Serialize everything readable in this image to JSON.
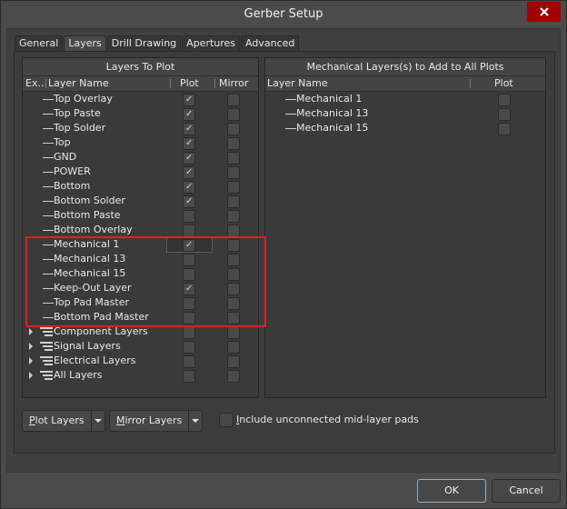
{
  "window": {
    "title": "Gerber Setup"
  },
  "tabs": [
    {
      "label": "General",
      "active": false
    },
    {
      "label": "Layers",
      "active": true
    },
    {
      "label": "Drill Drawing",
      "active": false
    },
    {
      "label": "Apertures",
      "active": false
    },
    {
      "label": "Advanced",
      "active": false
    }
  ],
  "layers_to_plot": {
    "title": "Layers To Plot",
    "columns": {
      "expand": "Ex...",
      "name": "Layer Name",
      "plot": "Plot",
      "mirror": "Mirror"
    },
    "layers": [
      {
        "name": "Top Overlay",
        "plot": true,
        "mirror": false
      },
      {
        "name": "Top Paste",
        "plot": true,
        "mirror": false
      },
      {
        "name": "Top Solder",
        "plot": true,
        "mirror": false
      },
      {
        "name": "Top",
        "plot": true,
        "mirror": false
      },
      {
        "name": "GND",
        "plot": true,
        "mirror": false
      },
      {
        "name": "POWER",
        "plot": true,
        "mirror": false
      },
      {
        "name": "Bottom",
        "plot": true,
        "mirror": false
      },
      {
        "name": "Bottom Solder",
        "plot": true,
        "mirror": false
      },
      {
        "name": "Bottom Paste",
        "plot": false,
        "mirror": false
      },
      {
        "name": "Bottom Overlay",
        "plot": false,
        "mirror": false
      },
      {
        "name": "Mechanical 1",
        "plot": true,
        "mirror": false,
        "focused": true
      },
      {
        "name": "Mechanical 13",
        "plot": false,
        "mirror": false
      },
      {
        "name": "Mechanical 15",
        "plot": false,
        "mirror": false
      },
      {
        "name": "Keep-Out Layer",
        "plot": true,
        "mirror": false
      },
      {
        "name": "Top Pad Master",
        "plot": false,
        "mirror": false
      },
      {
        "name": "Bottom Pad Master",
        "plot": false,
        "mirror": false
      }
    ],
    "groups": [
      {
        "name": "Component Layers",
        "plot": false,
        "mirror": false
      },
      {
        "name": "Signal Layers",
        "plot": false,
        "mirror": false
      },
      {
        "name": "Electrical Layers",
        "plot": false,
        "mirror": false
      },
      {
        "name": "All Layers",
        "plot": false,
        "mirror": false
      }
    ]
  },
  "mechanical_layers": {
    "title": "Mechanical Layers(s) to Add to All Plots",
    "columns": {
      "name": "Layer Name",
      "plot": "Plot"
    },
    "layers": [
      {
        "name": "Mechanical 1",
        "plot": false
      },
      {
        "name": "Mechanical 13",
        "plot": false
      },
      {
        "name": "Mechanical 15",
        "plot": false
      }
    ]
  },
  "controls": {
    "plot_layers": {
      "accel": "P",
      "rest": "lot Layers"
    },
    "mirror_layers": {
      "accel": "M",
      "rest": "irror Layers"
    },
    "include_pads": {
      "accel": "I",
      "rest": "nclude unconnected mid-layer pads",
      "checked": false
    }
  },
  "buttons": {
    "ok": "OK",
    "cancel": "Cancel"
  },
  "colors": {
    "highlight": "#e02020",
    "close": "#a30000"
  }
}
